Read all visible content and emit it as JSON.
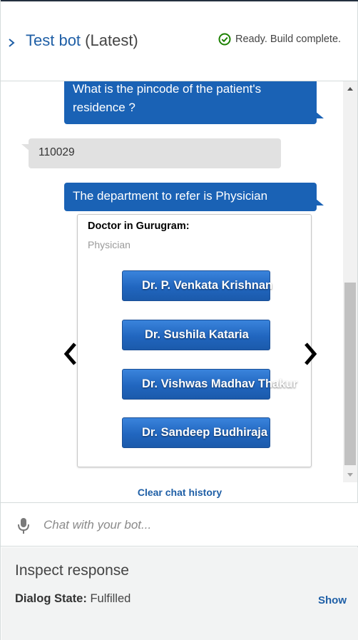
{
  "header": {
    "bot_name": "Test bot",
    "version": "(Latest)",
    "status_text": "Ready. Build complete.",
    "status_color": "#1d8102",
    "accent_color": "#1f5fa6"
  },
  "messages": {
    "bot_question": "What is the pincode of the patient's residence ?",
    "user_reply": "110029",
    "bot_department": "The department to refer is Physician"
  },
  "card": {
    "title": "Doctor in Gurugram:",
    "subtitle": "Physician",
    "buttons": [
      "Dr. P. Venkata Krishnan",
      "Dr. Sushila Kataria",
      "Dr. Vishwas Madhav Thakur",
      "Dr. Sandeep Budhiraja"
    ]
  },
  "chat": {
    "clear_history": "Clear chat history",
    "placeholder": "Chat with your bot..."
  },
  "inspect": {
    "title": "Inspect response",
    "dialog_state_label": "Dialog State:",
    "dialog_state_value": "Fulfilled",
    "show_label": "Show"
  },
  "icons": [
    "chevron-right-icon",
    "check-circle-icon",
    "carousel-prev-icon",
    "carousel-next-icon",
    "microphone-icon"
  ]
}
